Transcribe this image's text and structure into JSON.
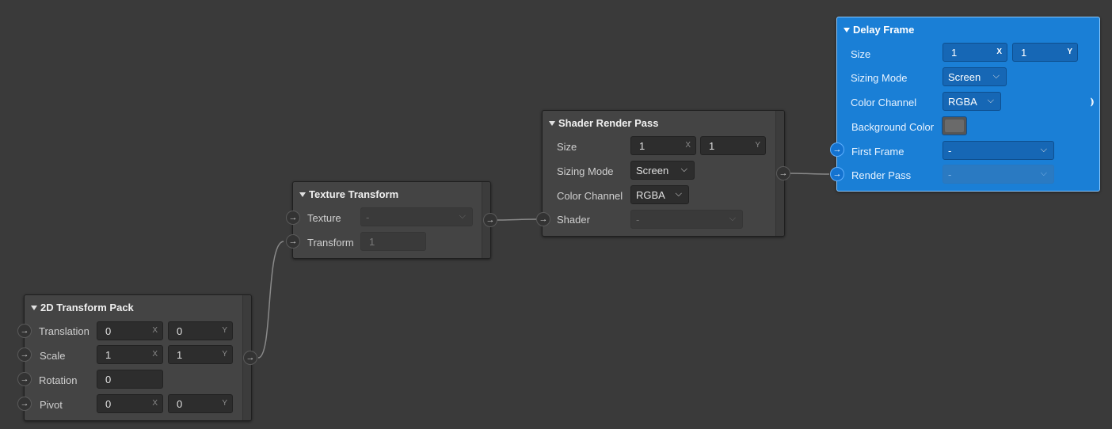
{
  "nodes": {
    "transform_pack": {
      "title": "2D Transform Pack",
      "rows": {
        "translation": {
          "label": "Translation",
          "x": "0",
          "y": "0"
        },
        "scale": {
          "label": "Scale",
          "x": "1",
          "y": "1"
        },
        "rotation": {
          "label": "Rotation",
          "value": "0"
        },
        "pivot": {
          "label": "Pivot",
          "x": "0",
          "y": "0"
        }
      }
    },
    "texture_transform": {
      "title": "Texture Transform",
      "texture": {
        "label": "Texture",
        "value": "-"
      },
      "transform": {
        "label": "Transform",
        "value": "1"
      }
    },
    "shader_render_pass": {
      "title": "Shader Render Pass",
      "size": {
        "label": "Size",
        "x": "1",
        "y": "1"
      },
      "sizing_mode": {
        "label": "Sizing Mode",
        "value": "Screen"
      },
      "color_channel": {
        "label": "Color Channel",
        "value": "RGBA"
      },
      "shader": {
        "label": "Shader",
        "value": "-"
      }
    },
    "delay_frame": {
      "title": "Delay Frame",
      "size": {
        "label": "Size",
        "x": "1",
        "y": "1"
      },
      "sizing_mode": {
        "label": "Sizing Mode",
        "value": "Screen"
      },
      "color_channel": {
        "label": "Color Channel",
        "value": "RGBA"
      },
      "background_color": {
        "label": "Background Color",
        "value": "#6a6a6a"
      },
      "first_frame": {
        "label": "First Frame",
        "value": "-"
      },
      "render_pass": {
        "label": "Render Pass",
        "value": "-"
      }
    }
  },
  "axis": {
    "x": "X",
    "y": "Y"
  },
  "icons": {
    "port": "arrow-right-icon",
    "collapse": "triangle-down-icon",
    "dropdown": "chevron-down-icon",
    "signal": "broadcast-icon"
  },
  "colors": {
    "canvas": "#2b2b2b",
    "node": "#444444",
    "selected": "#1a7fd6"
  }
}
